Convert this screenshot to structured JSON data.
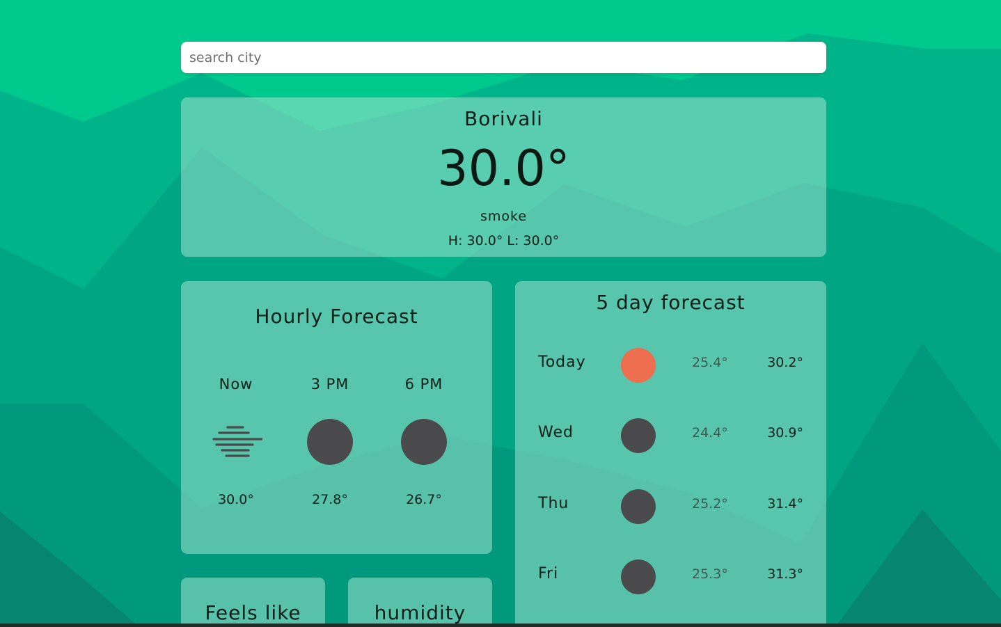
{
  "search": {
    "placeholder": "search city",
    "value": ""
  },
  "current": {
    "city": "Borivali",
    "temperature": "30.0°",
    "description": "smoke",
    "high_low": "H: 30.0° L: 30.0°"
  },
  "hourly": {
    "title": "Hourly Forecast",
    "items": [
      {
        "time": "Now",
        "temp": "30.0°",
        "icon": "smoke-haze-icon"
      },
      {
        "time": "3 PM",
        "temp": "27.8°",
        "icon": "moon-disc-icon"
      },
      {
        "time": "6 PM",
        "temp": "26.7°",
        "icon": "moon-disc-icon"
      }
    ]
  },
  "forecast": {
    "title": "5 day forecast",
    "days": [
      {
        "day": "Today",
        "low": "25.4°",
        "high": "30.2°",
        "icon": "sun-disc-icon",
        "icon_color": "#ee6e50"
      },
      {
        "day": "Wed",
        "low": "24.4°",
        "high": "30.9°",
        "icon": "moon-disc-icon",
        "icon_color": "#4a4a4c"
      },
      {
        "day": "Thu",
        "low": "25.2°",
        "high": "31.4°",
        "icon": "moon-disc-icon",
        "icon_color": "#4a4a4c"
      },
      {
        "day": "Fri",
        "low": "25.3°",
        "high": "31.3°",
        "icon": "moon-disc-icon",
        "icon_color": "#4a4a4c"
      }
    ]
  },
  "tiles": {
    "feels_like_title": "Feels like",
    "humidity_title": "humidity"
  },
  "colors": {
    "background": "#00c98d",
    "card": "rgba(160,225,205,0.55)",
    "sun": "#ee6e50",
    "moon": "#4a4a4c"
  }
}
